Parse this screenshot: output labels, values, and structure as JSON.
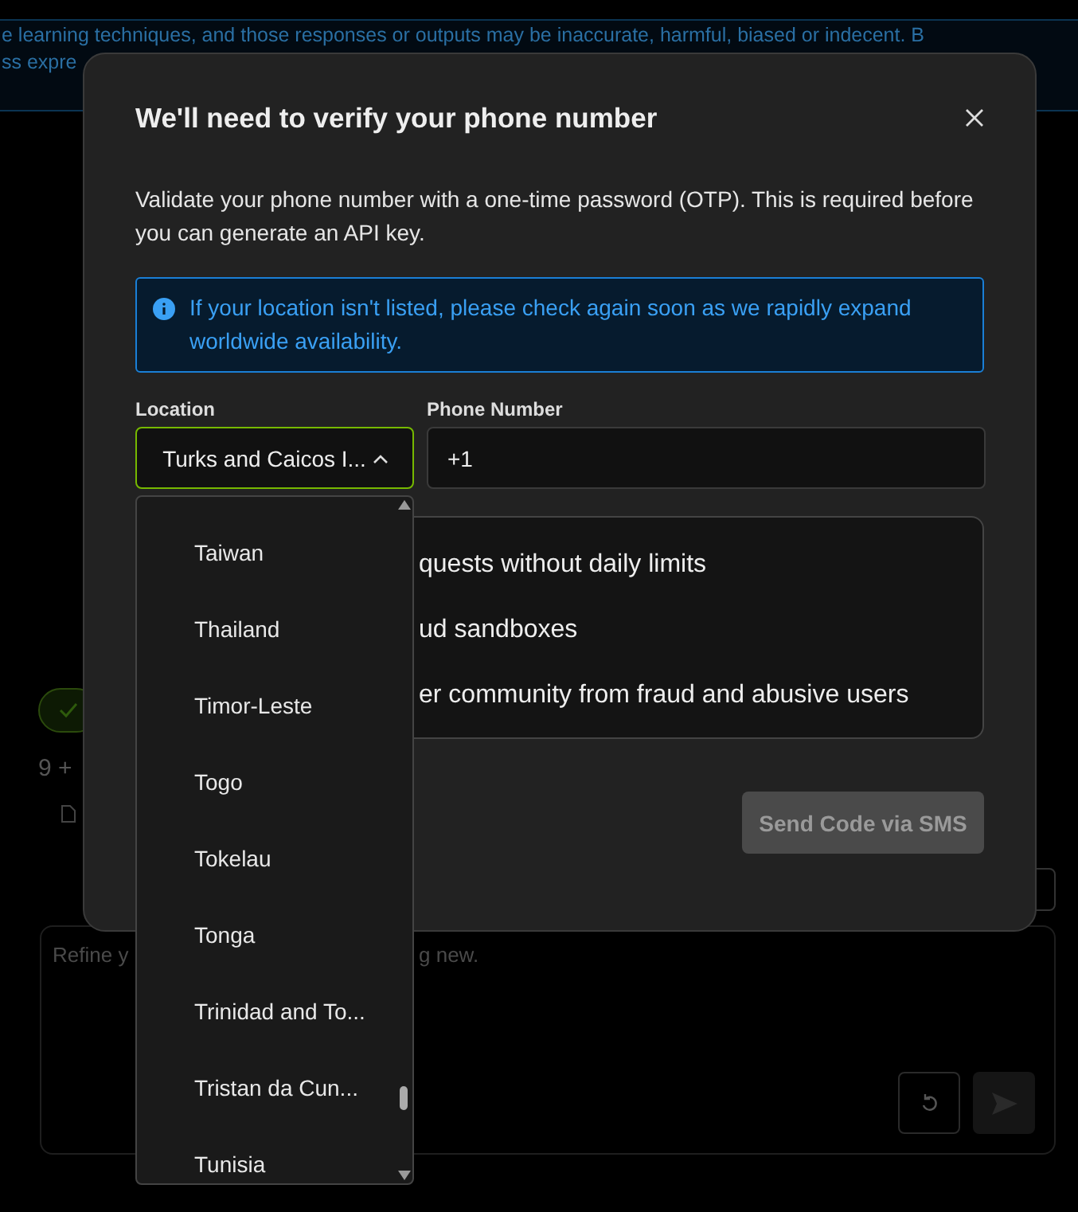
{
  "background": {
    "banner_lines": [
      "e learning techniques, and those responses or outputs may be inaccurate, harmful, biased or indecent. B",
      "ss expre"
    ],
    "snippet": "9 +",
    "prompt_field": {
      "placeholder_visible": [
        "Refine y",
        "g new."
      ]
    }
  },
  "dialog": {
    "title": "We'll need to verify your phone number",
    "description": "Validate your phone number with a one-time password (OTP). This is required before you can generate an API key.",
    "notice": "If your location isn't listed, please check again soon as we rapidly expand worldwide availability.",
    "location": {
      "label": "Location",
      "value": "Turks and Caicos I...",
      "expanded": true
    },
    "phone": {
      "label": "Phone Number",
      "value": "+1"
    },
    "benefits_visible": [
      "quests without daily limits",
      "ud sandboxes",
      "er community from fraud and abusive users"
    ],
    "send_button": {
      "label": "Send Code via SMS",
      "disabled": true
    }
  },
  "country_options": [
    {
      "label": "Taiwan",
      "selected": false
    },
    {
      "label": "Thailand",
      "selected": false
    },
    {
      "label": "Timor-Leste",
      "selected": false
    },
    {
      "label": "Togo",
      "selected": false
    },
    {
      "label": "Tokelau",
      "selected": false
    },
    {
      "label": "Tonga",
      "selected": false
    },
    {
      "label": "Trinidad and To...",
      "selected": false
    },
    {
      "label": "Tristan da Cun...",
      "selected": false
    },
    {
      "label": "Tunisia",
      "selected": false
    }
  ]
}
